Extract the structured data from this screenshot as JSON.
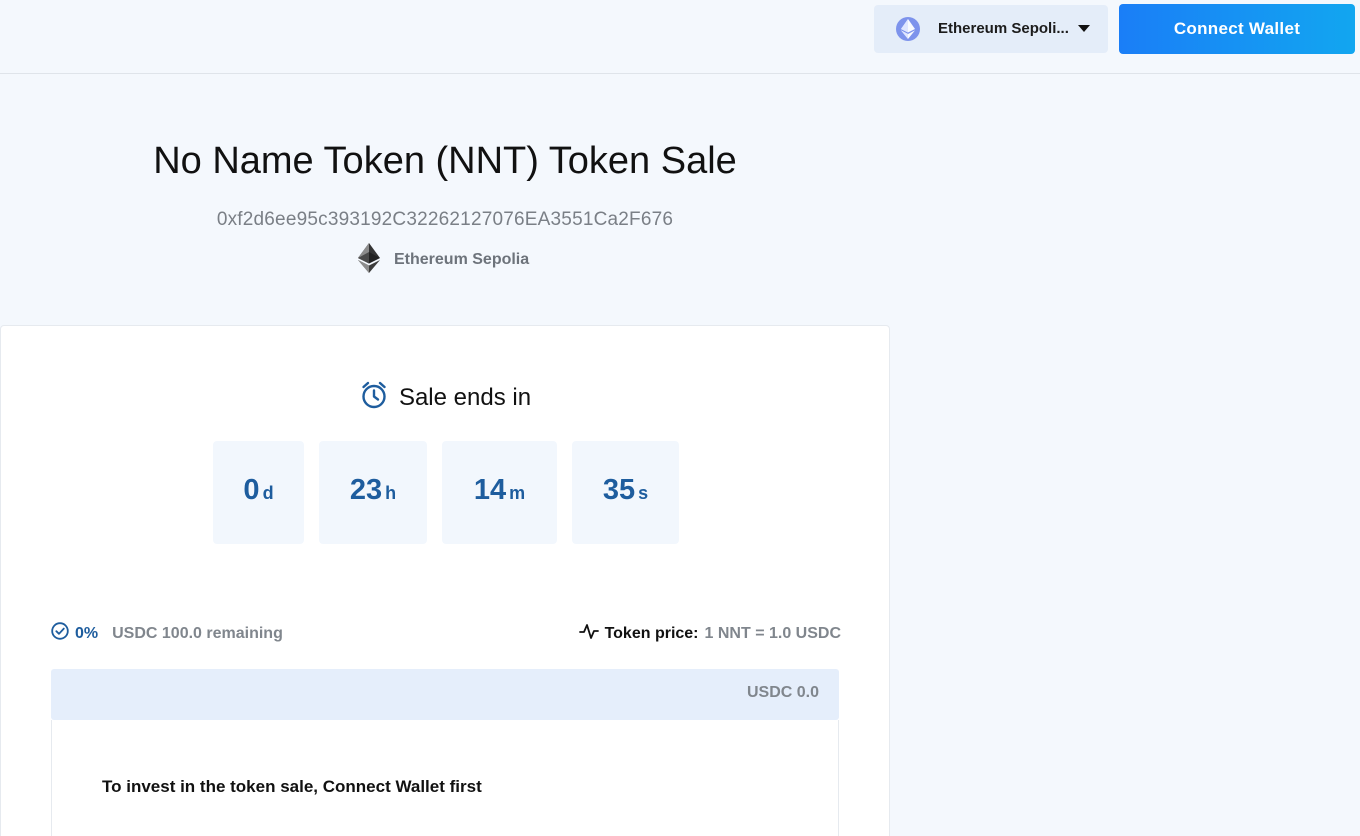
{
  "header": {
    "network_selector": {
      "label": "Ethereum Sepoli...",
      "icon": "ethereum-icon"
    },
    "connect_button": {
      "label": "Connect Wallet"
    }
  },
  "hero": {
    "title": "No Name Token (NNT) Token Sale",
    "contract_address": "0xf2d6ee95c393192C32262127076EA3551Ca2F676",
    "network_label": "Ethereum Sepolia"
  },
  "countdown": {
    "heading": "Sale ends in",
    "icon": "alarm-clock-icon",
    "units": [
      {
        "value": "0",
        "unit": "d"
      },
      {
        "value": "23",
        "unit": "h"
      },
      {
        "value": "14",
        "unit": "m"
      },
      {
        "value": "35",
        "unit": "s"
      }
    ]
  },
  "sale_stats": {
    "percent": "0%",
    "remaining": "USDC 100.0 remaining",
    "price_label": "Token price:",
    "price_value": "1 NNT = 1.0 USDC"
  },
  "progress": {
    "fraction": 0,
    "amount": "USDC 0.0"
  },
  "invest": {
    "message": "To invest in the token sale, Connect Wallet first"
  },
  "colors": {
    "accent": "#1a7ef7",
    "accent_gradient_end": "#12a6f0",
    "countdown_text": "#1e5d9e",
    "page_background": "#f4f8fd",
    "muted_text": "#80868d"
  }
}
